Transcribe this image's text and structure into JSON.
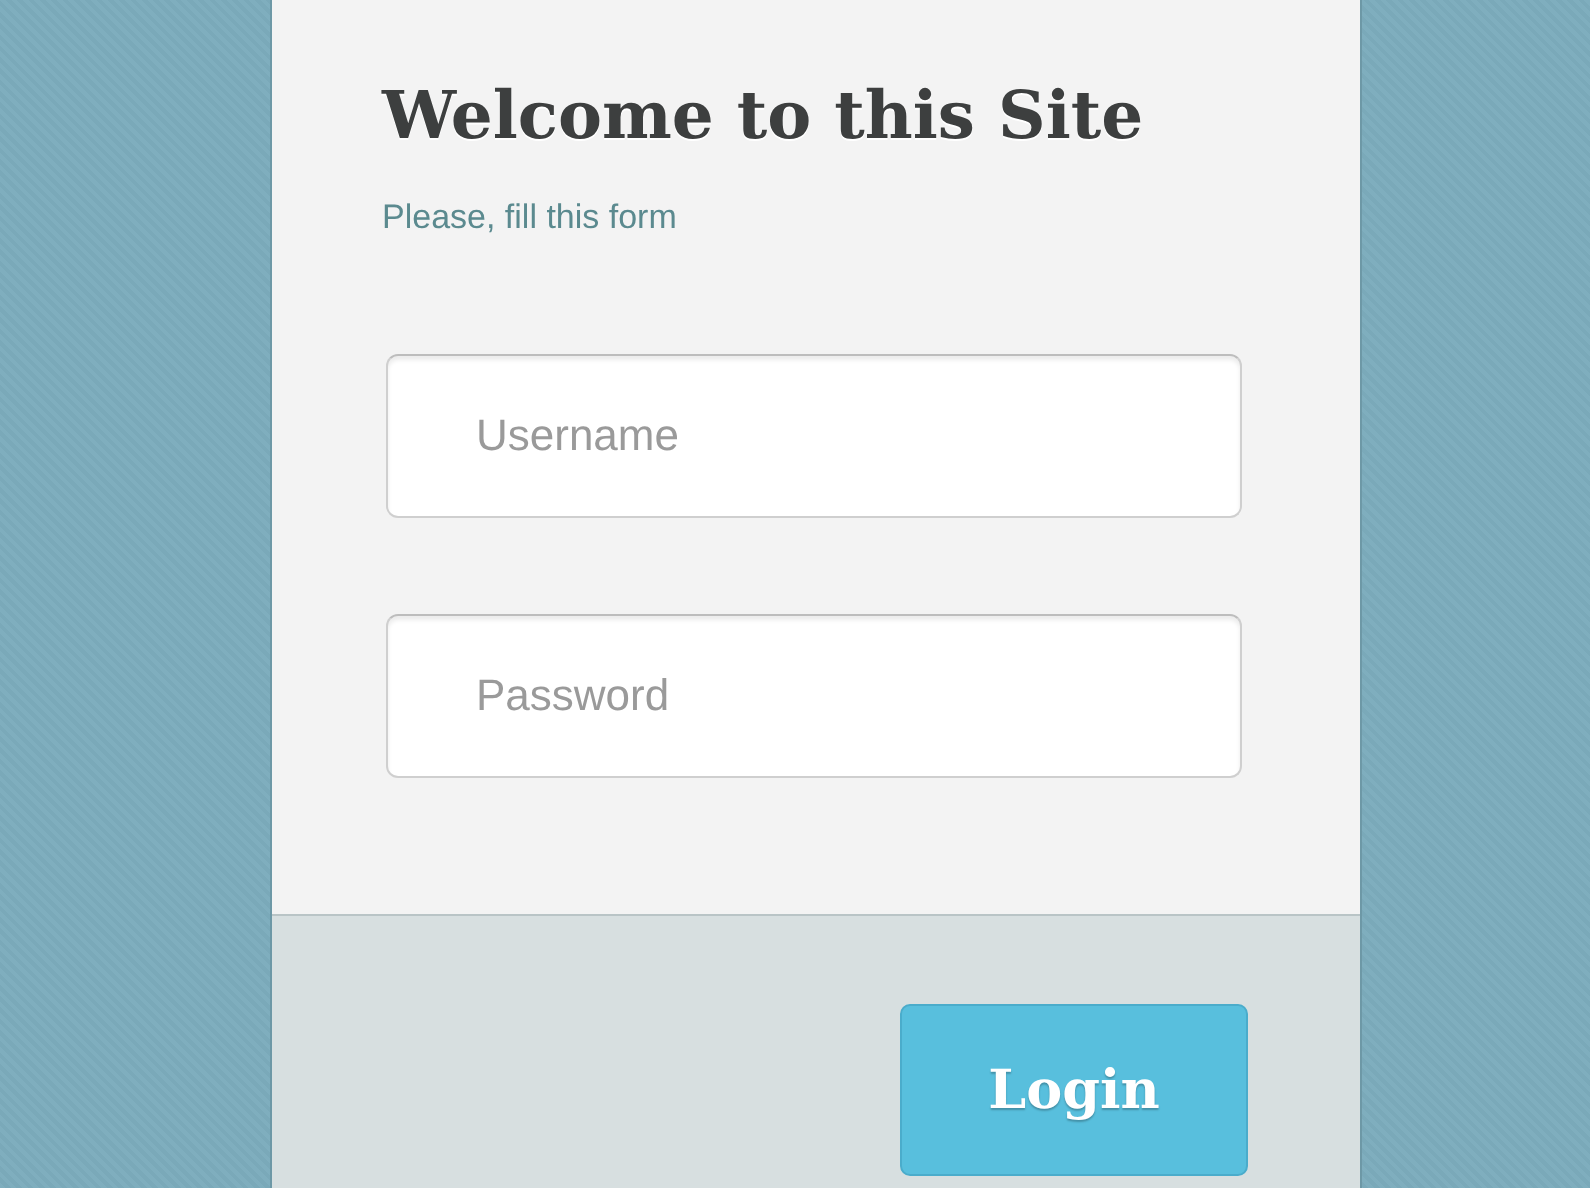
{
  "form": {
    "title": "Welcome to this Site",
    "subtitle": "Please, fill this form",
    "fields": [
      {
        "placeholder": "Username"
      },
      {
        "placeholder": "Password"
      }
    ],
    "button": "Login"
  }
}
